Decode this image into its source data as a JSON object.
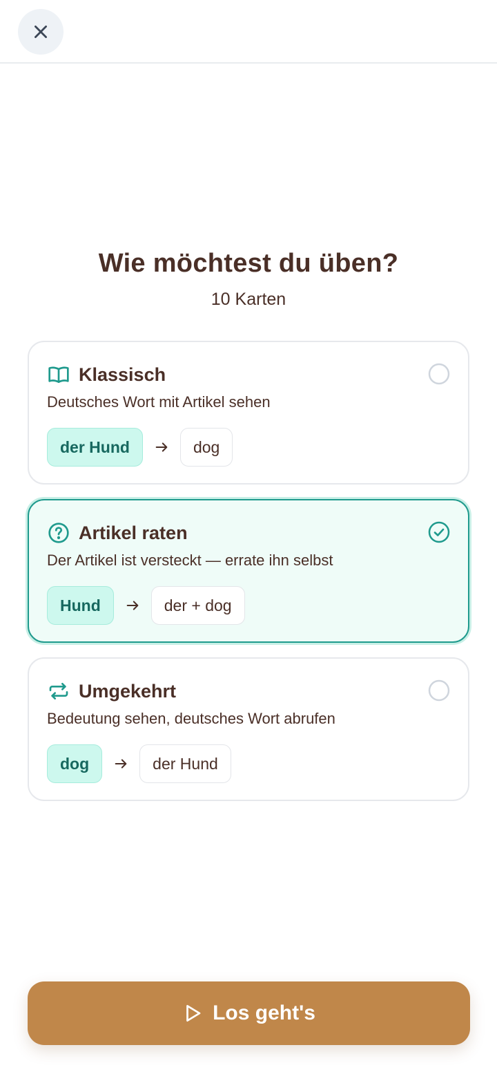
{
  "header": {
    "close_icon": "close-icon"
  },
  "main": {
    "title": "Wie möchtest du üben?",
    "subtitle": "10 Karten"
  },
  "modes": [
    {
      "title": "Klassisch",
      "description": "Deutsches Wort mit Artikel sehen",
      "icon": "open-book-icon",
      "selected": false,
      "example_front": "der Hund",
      "example_back": "dog"
    },
    {
      "title": "Artikel raten",
      "description": "Der Artikel ist versteckt — errate ihn selbst",
      "icon": "question-circle-icon",
      "selected": true,
      "example_front": "Hund",
      "example_back": "der + dog"
    },
    {
      "title": "Umgekehrt",
      "description": "Bedeutung sehen, deutsches Wort abrufen",
      "icon": "repeat-arrows-icon",
      "selected": false,
      "example_front": "dog",
      "example_back": "der Hund"
    }
  ],
  "cta": {
    "label": "Los geht's",
    "icon": "play-icon"
  },
  "colors": {
    "accent": "#1f9a8d",
    "selected_bg": "#effcf8",
    "chip_bg": "#cdf8ee",
    "cta_bg": "#c0874a",
    "text": "#4a2f27"
  }
}
